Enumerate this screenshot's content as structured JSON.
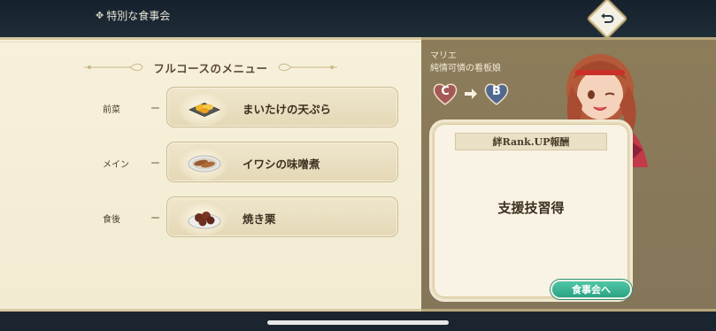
{
  "screen": {
    "title": "特別な食事会",
    "title_deco_icon": "diamond-flower-ornament",
    "back_icon": "return-arrow-icon"
  },
  "menu": {
    "heading": "フルコースのメニュー",
    "courses": [
      {
        "label": "前菜",
        "dash": "ー",
        "dish": "まいたけの天ぷら",
        "icon": "tempura-plate-icon"
      },
      {
        "label": "メイン",
        "dash": "ー",
        "dish": "イワシの味噌煮",
        "icon": "fish-stew-plate-icon"
      },
      {
        "label": "食後",
        "dash": "ー",
        "dish": "焼き栗",
        "icon": "roasted-chestnut-plate-icon"
      }
    ]
  },
  "character": {
    "name": "マリエ",
    "title": "純情可憐の看板娘",
    "rank_from": "C",
    "rank_to": "B"
  },
  "reward": {
    "header": "絆Rank.UP報酬",
    "text": "支援技習得",
    "button_label": "食事会へ"
  },
  "colors": {
    "accent_green": "#2aa383",
    "rank_from_color": "#a35a57",
    "rank_to_color": "#50698f",
    "panel_cream": "#f7f1dc",
    "panel_brown": "#8c7c5a"
  }
}
